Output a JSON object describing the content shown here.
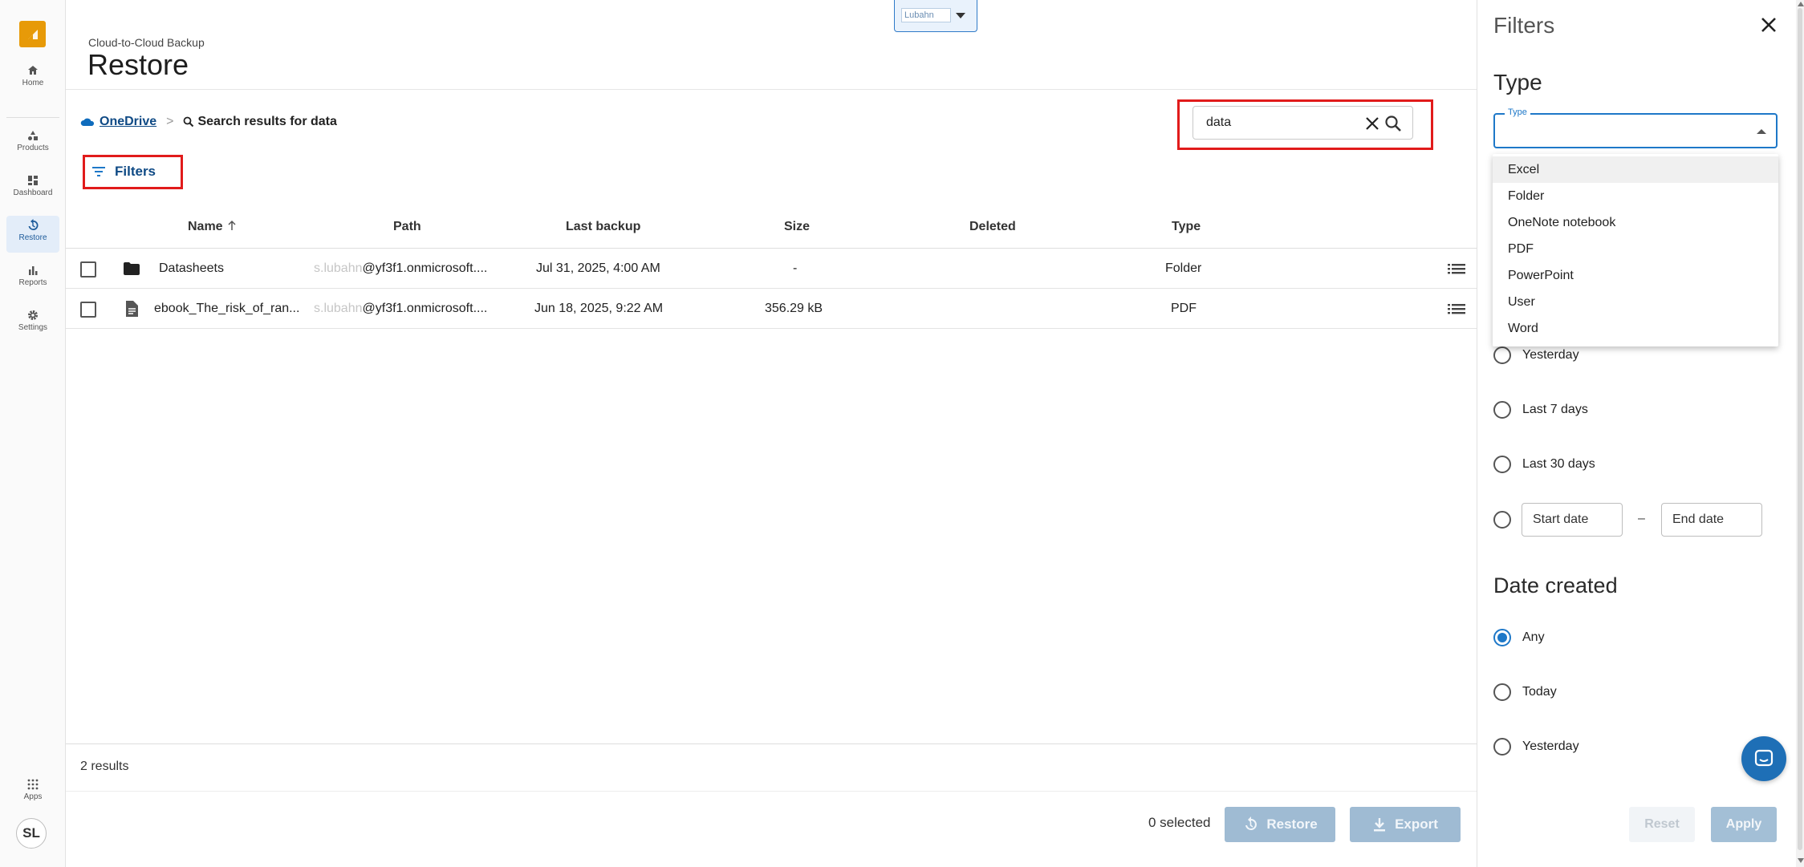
{
  "nav": {
    "items": [
      {
        "label": "Home",
        "icon": "home-icon"
      },
      {
        "label": "Products",
        "icon": "products-icon"
      },
      {
        "label": "Dashboard",
        "icon": "dashboard-icon"
      },
      {
        "label": "Restore",
        "icon": "restore-icon"
      },
      {
        "label": "Reports",
        "icon": "reports-icon"
      },
      {
        "label": "Settings",
        "icon": "gear-icon"
      }
    ],
    "apps_label": "Apps",
    "avatar_initials": "SL"
  },
  "header": {
    "subtitle": "Cloud-to-Cloud Backup",
    "title": "Restore",
    "tenant_value": "Lubahn"
  },
  "breadcrumb": {
    "root": "OneDrive",
    "separator": ">",
    "search_label": "Search results for data"
  },
  "search": {
    "value": "data"
  },
  "filters_button": {
    "label": "Filters"
  },
  "table": {
    "columns": [
      "Name",
      "Path",
      "Last backup",
      "Size",
      "Deleted",
      "Type"
    ],
    "rows": [
      {
        "name": "Datasheets",
        "path_blurred": "s.lubahn",
        "path": "@yf3f1.onmicrosoft....",
        "last_backup": "Jul 31, 2025, 4:00 AM",
        "size": "-",
        "deleted": "",
        "type": "Folder",
        "icon": "folder-icon"
      },
      {
        "name": "ebook_The_risk_of_ran...",
        "path_blurred": "s.lubahn",
        "path": "@yf3f1.onmicrosoft....",
        "last_backup": "Jun 18, 2025, 9:22 AM",
        "size": "356.29 kB",
        "deleted": "",
        "type": "PDF",
        "icon": "document-icon"
      }
    ]
  },
  "footer": {
    "results": "2 results",
    "selected": "0 selected",
    "restore_label": "Restore",
    "export_label": "Export"
  },
  "panel": {
    "title": "Filters",
    "type_section": "Type",
    "type_field_label": "Type",
    "type_options": [
      "Excel",
      "Folder",
      "OneNote notebook",
      "PDF",
      "PowerPoint",
      "User",
      "Word"
    ],
    "backup_date_options": [
      "Yesterday",
      "Last 7 days",
      "Last 30 days"
    ],
    "start_date_placeholder": "Start date",
    "date_range_dash": "–",
    "end_date_placeholder": "End date",
    "date_created_section": "Date created",
    "date_created_options": [
      "Any",
      "Today",
      "Yesterday"
    ],
    "reset_label": "Reset",
    "apply_label": "Apply"
  },
  "colors": {
    "accent": "#1e78c8",
    "link": "#0f4a85",
    "highlight": "#e11b1b",
    "logo": "#e79a08",
    "disabled_button": "#9fbbd3"
  }
}
